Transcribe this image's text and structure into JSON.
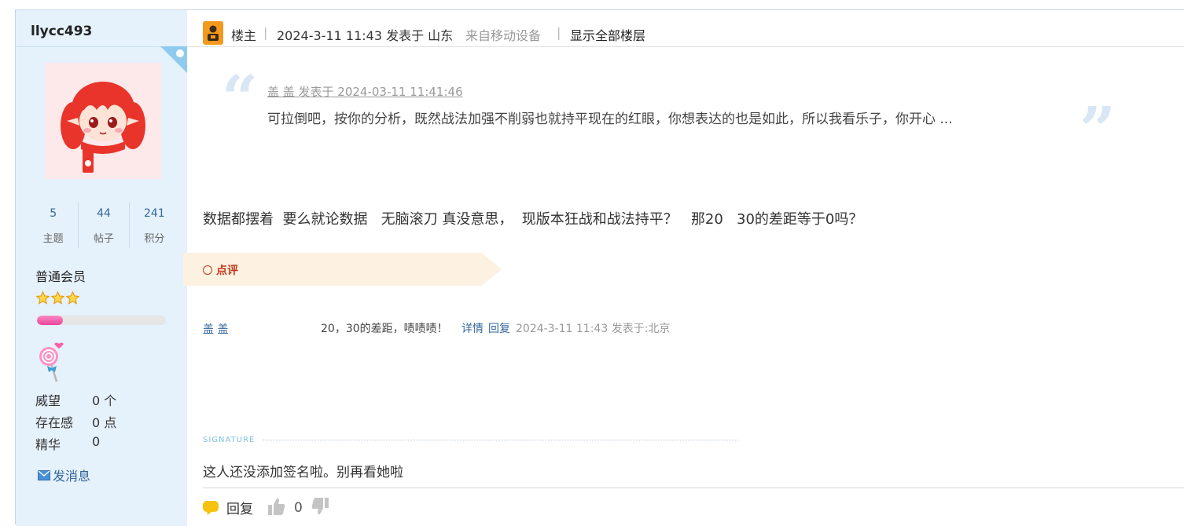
{
  "author": {
    "username": "llycc493",
    "stats": [
      {
        "value": "5",
        "label": "主题"
      },
      {
        "value": "44",
        "label": "帖子"
      },
      {
        "value": "241",
        "label": "积分"
      }
    ],
    "group": "普通会员",
    "star_count": 3,
    "level_progress": 0.2,
    "properties": [
      {
        "key": "威望",
        "value": "0 个"
      },
      {
        "key": "存在感",
        "value": "0 点"
      },
      {
        "key": "精华",
        "value": "0"
      }
    ],
    "send_message_label": "发消息"
  },
  "post": {
    "op_label": "楼主",
    "separator": "|",
    "posted_at": "2024-3-11 11:43 发表于 山东",
    "device": "来自移动设备",
    "show_all_label": "显示全部楼层",
    "quote": {
      "author_line": "盖 盖 发表于 2024-03-11 11:41:46",
      "text": "可拉倒吧，按你的分析，既然战法加强不削弱也就持平现在的红眼，你想表达的也是如此，所以我看乐子，你开心 ..."
    },
    "body": "数据都摆着  要么就论数据   无脑滚刀 真没意思，  现版本狂战和战法持平？   那20   30的差距等于0吗？",
    "comment_section_label": "点评",
    "comments": [
      {
        "user": "盖 盖",
        "text": "20，30的差距，啧啧啧！",
        "detail_label": "详情",
        "reply_label": "回复",
        "meta": "2024-3-11 11:43 发表于:北京"
      }
    ],
    "signature_label": "SIGNATURE",
    "signature": "这人还没添加签名啦。别再看她啦",
    "reply_label": "回复",
    "like_count": "0"
  },
  "colors": {
    "sidebar_bg": "#e5f1fb",
    "link": "#336699",
    "comment_accent": "#c0391b",
    "banner": "#fdf2e2",
    "progress_fill": "#e8459a"
  },
  "icons": {
    "op": "op-badge-icon",
    "star": "star-icon",
    "mail": "mail-icon",
    "reply": "speech-bubble-icon",
    "like": "thumbs-up-icon",
    "dislike": "thumbs-down-icon"
  }
}
